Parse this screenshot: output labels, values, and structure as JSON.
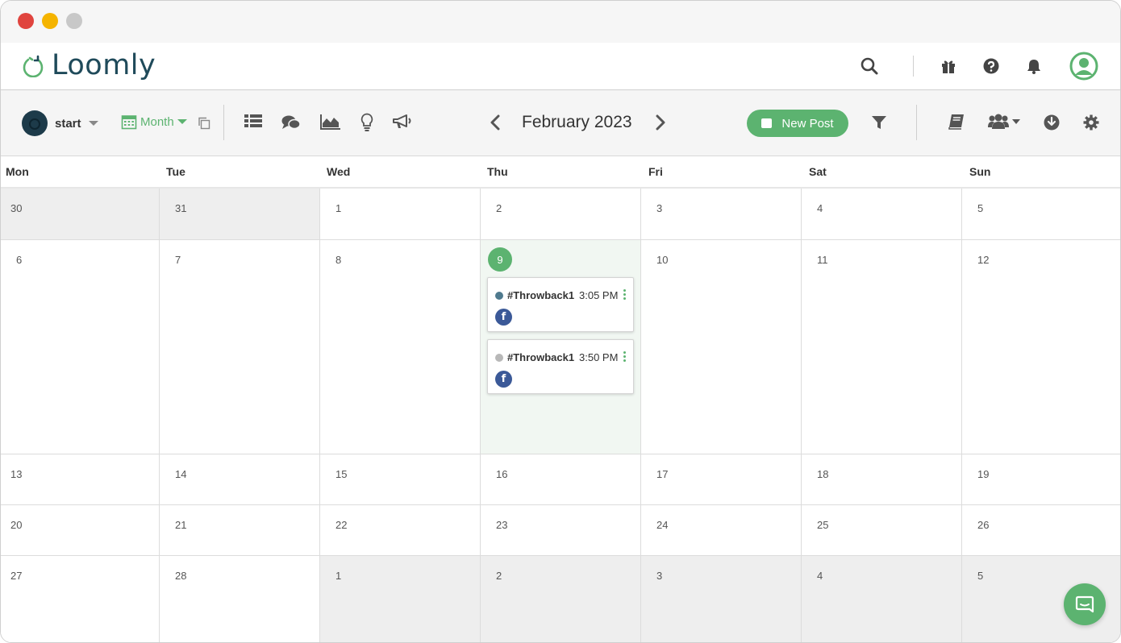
{
  "app": {
    "name": "Loomly"
  },
  "header": {
    "icons": [
      "search-icon",
      "gift-icon",
      "help-icon",
      "bell-icon",
      "user-icon"
    ]
  },
  "toolbar": {
    "account_name": "start",
    "view_label": "Month",
    "period_label": "February 2023",
    "new_post_label": "New Post",
    "view_icons": [
      "list-icon",
      "comments-icon",
      "analytics-icon",
      "ideas-icon",
      "announcement-icon"
    ],
    "right_icons": [
      "filter-icon",
      "library-icon",
      "team-icon",
      "download-icon",
      "settings-icon"
    ]
  },
  "calendar": {
    "day_names": [
      "Mon",
      "Tue",
      "Wed",
      "Thu",
      "Fri",
      "Sat",
      "Sun"
    ],
    "today": "9",
    "weeks": [
      [
        "30",
        "31",
        "1",
        "2",
        "3",
        "4",
        "5"
      ],
      [
        "6",
        "7",
        "8",
        "9",
        "10",
        "11",
        "12"
      ],
      [
        "13",
        "14",
        "15",
        "16",
        "17",
        "18",
        "19"
      ],
      [
        "20",
        "21",
        "22",
        "23",
        "24",
        "25",
        "26"
      ],
      [
        "27",
        "28",
        "1",
        "2",
        "3",
        "4",
        "5"
      ]
    ],
    "posts": [
      {
        "title": "#Throwback1",
        "time": "3:05 PM",
        "status_color": "#4f7a8e",
        "channel": "facebook-icon"
      },
      {
        "title": "#Throwback1",
        "time": "3:50 PM",
        "status_color": "#b8b8b8",
        "channel": "facebook-icon"
      }
    ]
  },
  "colors": {
    "accent": "#5cb370",
    "brand_dark": "#1f4a5a",
    "facebook": "#3b5998"
  }
}
